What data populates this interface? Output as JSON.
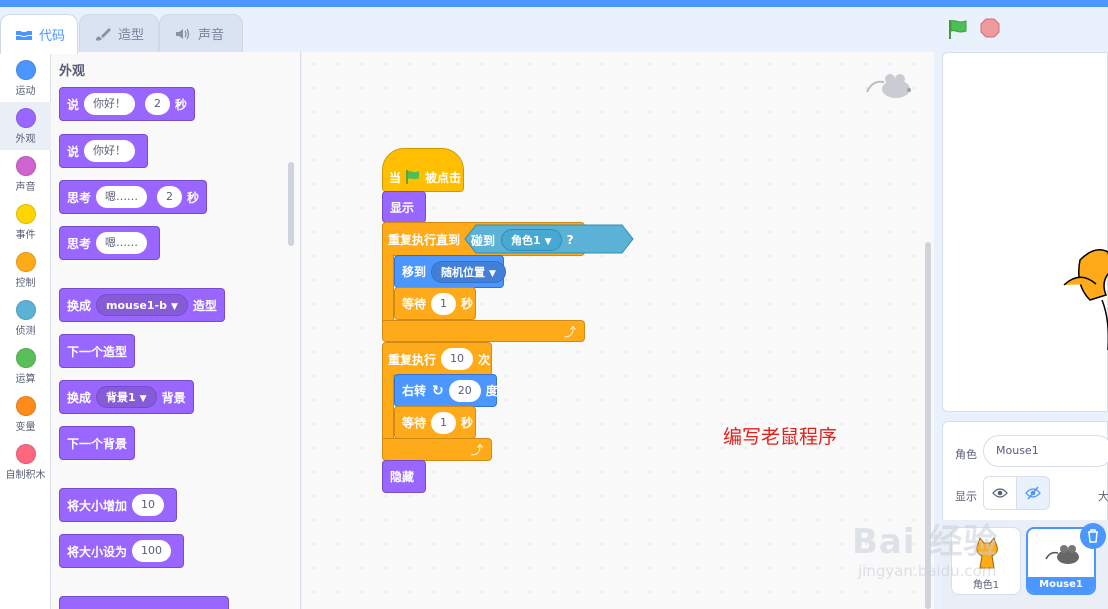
{
  "tabs": [
    {
      "label": "代码",
      "active": true
    },
    {
      "label": "造型",
      "active": false
    },
    {
      "label": "声音",
      "active": false
    }
  ],
  "categories": [
    {
      "label": "运动",
      "color": "#4c97ff"
    },
    {
      "label": "外观",
      "color": "#9966ff",
      "active": true
    },
    {
      "label": "声音",
      "color": "#cf63cf"
    },
    {
      "label": "事件",
      "color": "#ffd500"
    },
    {
      "label": "控制",
      "color": "#ffab19"
    },
    {
      "label": "侦测",
      "color": "#5cb1d6"
    },
    {
      "label": "运算",
      "color": "#59c059"
    },
    {
      "label": "变量",
      "color": "#ff8c1a"
    },
    {
      "label": "自制积木",
      "color": "#ff6680"
    }
  ],
  "palette": {
    "title": "外观",
    "say_secs": {
      "cmd": "说",
      "msg": "你好！",
      "secs": "2",
      "unit": "秒"
    },
    "say": {
      "cmd": "说",
      "msg": "你好！"
    },
    "think_secs": {
      "cmd": "思考",
      "msg": "嗯……",
      "secs": "2",
      "unit": "秒"
    },
    "think": {
      "cmd": "思考",
      "msg": "嗯……"
    },
    "switch_costume": {
      "cmd": "换成",
      "value": "mouse1-b",
      "suffix": "造型"
    },
    "next_costume": "下一个造型",
    "switch_backdrop": {
      "cmd": "换成",
      "value": "背景1",
      "suffix": "背景"
    },
    "next_backdrop": "下一个背景",
    "change_size": {
      "cmd": "将大小增加",
      "value": "10"
    },
    "set_size": {
      "cmd": "将大小设为",
      "value": "100"
    }
  },
  "script": {
    "hat": {
      "pre": "当",
      "post": "被点击"
    },
    "show": "显示",
    "repeat_until": {
      "cmd": "重复执行直到",
      "touch": "碰到",
      "target": "角色1",
      "q": "?"
    },
    "goto": {
      "cmd": "移到",
      "value": "随机位置"
    },
    "wait1": {
      "cmd": "等待",
      "value": "1",
      "unit": "秒"
    },
    "repeat": {
      "cmd": "重复执行",
      "value": "10",
      "unit": "次"
    },
    "turn": {
      "cmd": "右转",
      "value": "20",
      "unit": "度"
    },
    "wait2": {
      "cmd": "等待",
      "value": "1",
      "unit": "秒"
    },
    "hide": "隐藏"
  },
  "annotation": "编写老鼠程序",
  "sprite_pane": {
    "sprite_label": "角色",
    "sprite_name": "Mouse1",
    "show_label": "显示",
    "size_label_partial": "大"
  },
  "sprites": [
    {
      "name": "角色1",
      "selected": false
    },
    {
      "name": "Mouse1",
      "selected": true
    }
  ],
  "watermark": {
    "main": "Bai 经验",
    "sub": "jingyan.baidu.com"
  }
}
